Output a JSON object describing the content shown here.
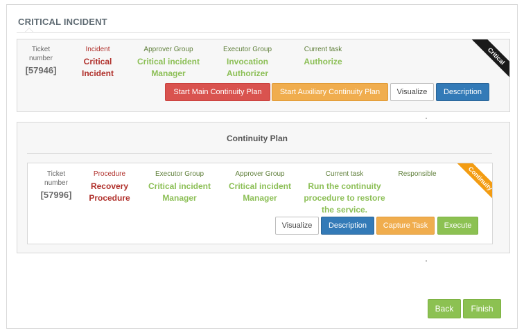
{
  "section": {
    "title": "CRITICAL INCIDENT"
  },
  "incident": {
    "ticket": {
      "label": "Ticket number",
      "value": "[57946]"
    },
    "type": {
      "label": "Incident",
      "value": "Critical Incident"
    },
    "approver": {
      "label": "Approver Group",
      "value": "Critical incident Manager"
    },
    "executor": {
      "label": "Executor Group",
      "value": "Invocation Authorizer"
    },
    "task": {
      "label": "Current task",
      "value": "Authorize"
    },
    "ribbon": "Critical",
    "buttons": {
      "start_main": "Start Main Continuity Plan",
      "start_aux": "Start Auxiliary Continuity Plan",
      "visualize": "Visualize",
      "description": "Description"
    }
  },
  "plan": {
    "title": "Continuity Plan",
    "ticket": {
      "label": "Ticket number",
      "value": "[57996]"
    },
    "procedure": {
      "label": "Procedure",
      "value": "Recovery Procedure"
    },
    "executor": {
      "label": "Executor Group",
      "value": "Critical incident Manager"
    },
    "approver": {
      "label": "Approver Group",
      "value": "Critical incident Manager"
    },
    "task": {
      "label": "Current task",
      "value": "Run the continuity procedure to restore the service."
    },
    "responsible": {
      "label": "Responsible",
      "value": ""
    },
    "ribbon": "Continuity",
    "buttons": {
      "visualize": "Visualize",
      "description": "Description",
      "capture": "Capture Task",
      "execute": "Execute"
    }
  },
  "footer": {
    "back": "Back",
    "finish": "Finish"
  },
  "colors": {
    "red": "#d9534f",
    "orange": "#f0ad4e",
    "blue": "#337ab7",
    "green": "#8cc152",
    "text_red": "#b0302b",
    "text_green": "#8cbf56"
  }
}
